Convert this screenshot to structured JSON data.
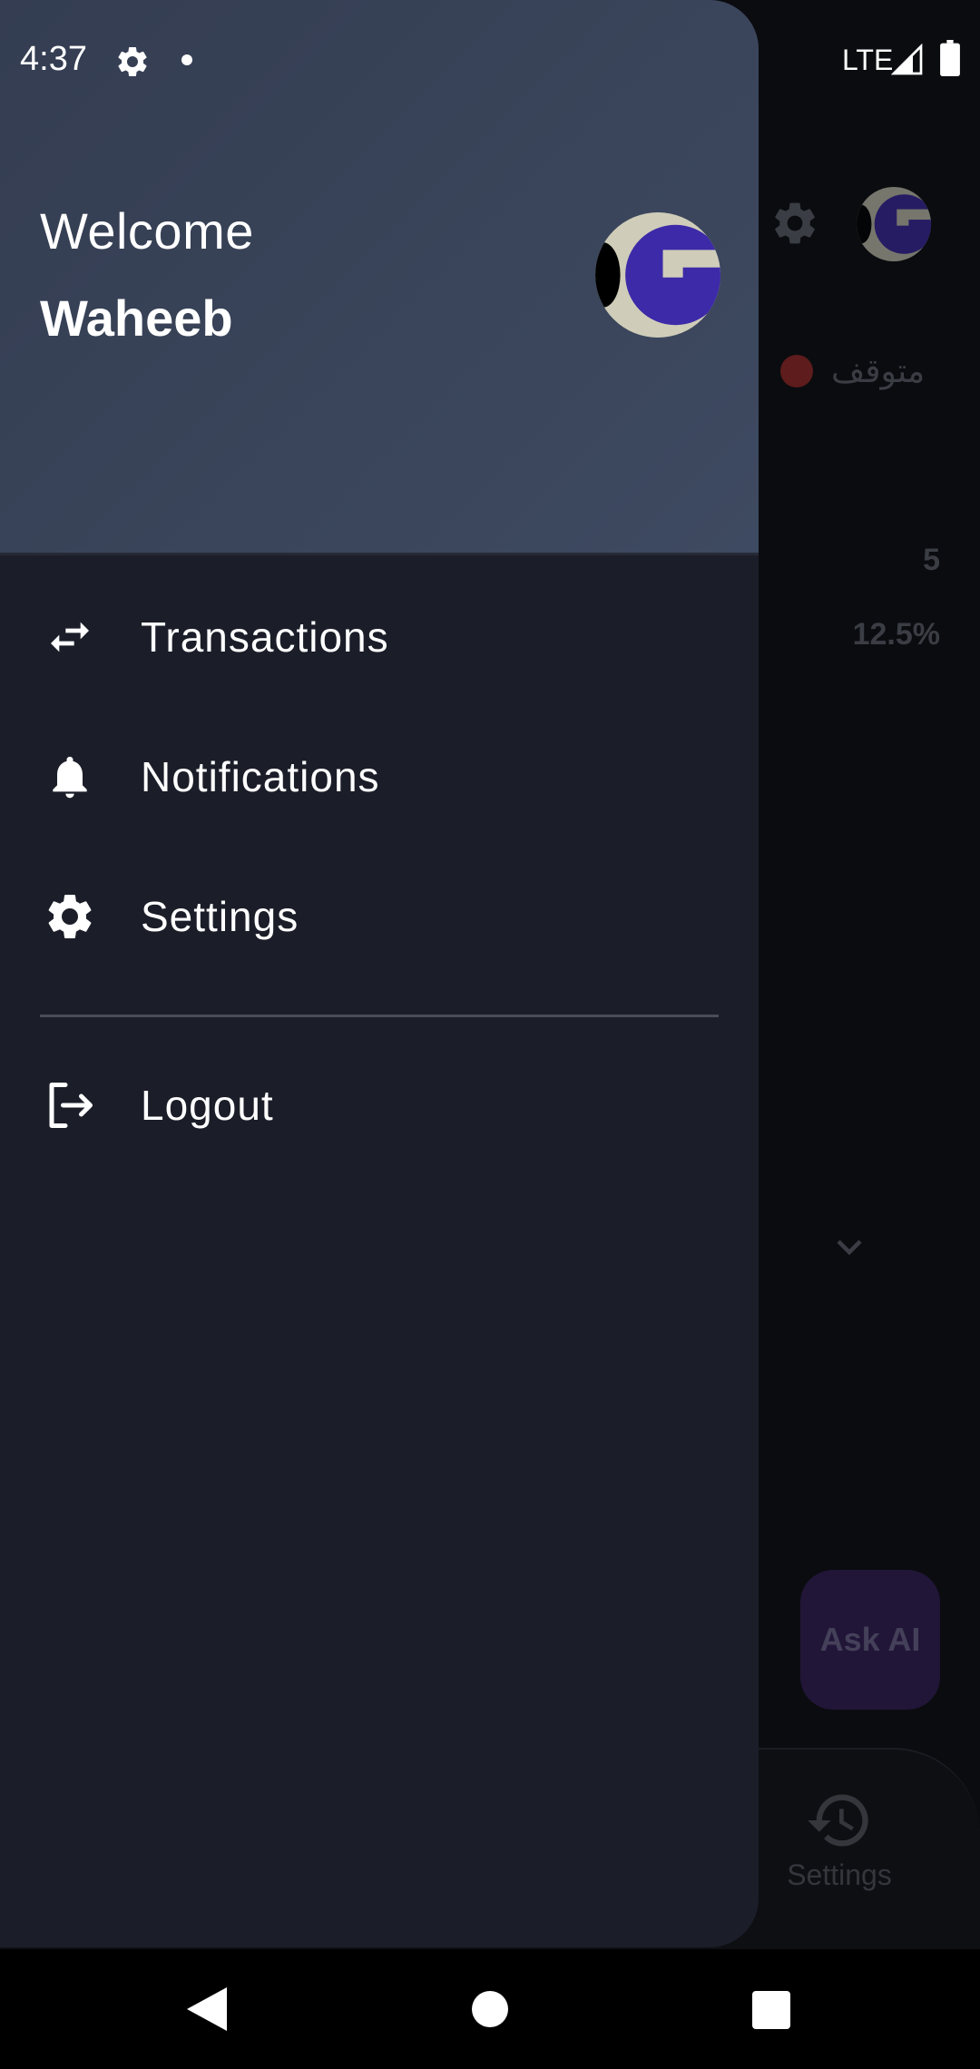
{
  "status_bar": {
    "time": "4:37",
    "network": "LTE",
    "icons": [
      "gear-icon",
      "notification-dot-icon",
      "signal-icon",
      "battery-icon"
    ]
  },
  "background_screen": {
    "status_text": "متوقف",
    "status_color": "#5e1c1c",
    "value_1": "5",
    "value_2": "12.5%",
    "ask_ai_label": "Ask AI",
    "bottom_nav_label": "Settings"
  },
  "drawer": {
    "welcome": "Welcome",
    "username": "Waheeb",
    "menu": [
      {
        "label": "Transactions",
        "icon": "swap-arrows-icon"
      },
      {
        "label": "Notifications",
        "icon": "bell-icon"
      },
      {
        "label": "Settings",
        "icon": "gear-icon"
      }
    ],
    "logout_label": "Logout",
    "logout_icon": "logout-icon"
  },
  "colors": {
    "drawer_bg": "#1b1e29",
    "header_bg": "#3a4459",
    "accent_logo": "#3d2aa8",
    "text": "#ffffff"
  },
  "nav_bar": {
    "icons": [
      "back-icon",
      "home-icon",
      "recents-icon"
    ]
  }
}
